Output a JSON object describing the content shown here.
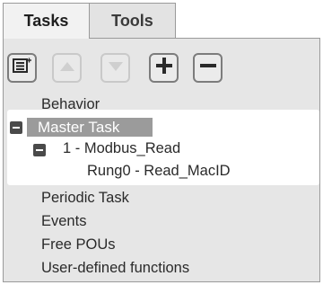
{
  "tabs": [
    {
      "label": "Tasks",
      "active": true
    },
    {
      "label": "Tools",
      "active": false
    }
  ],
  "toolbar": {
    "buttons": [
      {
        "icon": "add-task-list-icon"
      },
      {
        "icon": "arrow-up-icon",
        "disabled": true
      },
      {
        "icon": "arrow-down-icon",
        "disabled": true
      },
      {
        "icon": "plus-icon"
      },
      {
        "icon": "minus-icon"
      }
    ]
  },
  "tree": {
    "behavior": "Behavior",
    "master_task": "Master Task",
    "modbus_read": "1 - Modbus_Read",
    "rung0": "Rung0 - Read_MacID",
    "periodic_task": "Periodic Task",
    "events": "Events",
    "free_pous": "Free POUs",
    "user_defined": "User-defined functions"
  },
  "colors": {
    "panel_bg": "#e6e6e6",
    "selection_bg": "#9b9b9b",
    "highlight_bg": "#ffffff",
    "button_border": "#7c7c7c"
  }
}
